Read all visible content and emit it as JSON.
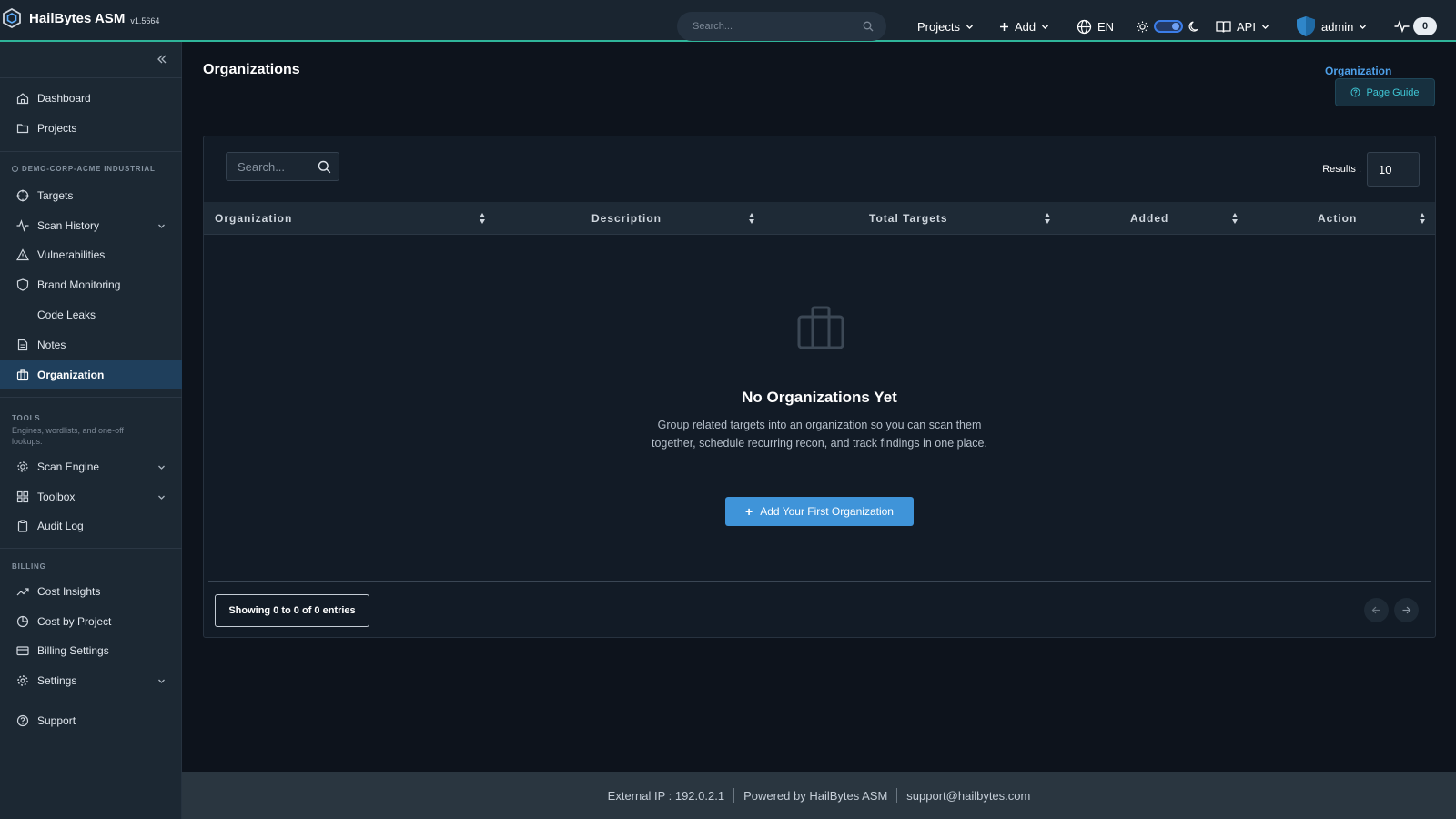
{
  "app": {
    "name": "HailBytes ASM",
    "version": "v1.5664"
  },
  "topbar": {
    "search_placeholder": "Search...",
    "projects_label": "Projects",
    "add_label": "Add",
    "language": "EN",
    "api_label": "API",
    "user": "admin",
    "notification_count": "0"
  },
  "sidebar": {
    "dashboard": "Dashboard",
    "projects": "Projects",
    "project_section": "DEMO-CORP-ACME INDUSTRIAL",
    "targets": "Targets",
    "scan_history": "Scan History",
    "vulnerabilities": "Vulnerabilities",
    "brand_monitoring": "Brand Monitoring",
    "code_leaks": "Code Leaks",
    "notes": "Notes",
    "organization": "Organization",
    "tools_section": "TOOLS",
    "tools_sub": "Engines, wordlists, and one-off lookups.",
    "scan_engine": "Scan Engine",
    "toolbox": "Toolbox",
    "audit_log": "Audit Log",
    "billing_section": "BILLING",
    "cost_insights": "Cost Insights",
    "cost_by_project": "Cost by Project",
    "billing_settings": "Billing Settings",
    "settings": "Settings",
    "support": "Support"
  },
  "main": {
    "title": "Organizations",
    "breadcrumb": "Organization",
    "page_guide": "Page Guide",
    "search_placeholder": "Search...",
    "results_label": "Results :",
    "results_value": "10",
    "columns": [
      "Organization",
      "Description",
      "Total Targets",
      "Added",
      "Action"
    ],
    "empty_title": "No Organizations Yet",
    "empty_desc": "Group related targets into an organization so you can scan them together, schedule recurring recon, and track findings in one place.",
    "add_button": "Add Your First Organization",
    "entries": "Showing 0 to 0 of 0 entries"
  },
  "footer": {
    "external_ip": "External IP : 192.0.2.1",
    "powered_by": "Powered by HailBytes ASM",
    "support_email": "support@hailbytes.com"
  },
  "colors": {
    "accent": "#3f94d9",
    "topbar_border": "#2fb59a",
    "link": "#4ea1ea"
  }
}
